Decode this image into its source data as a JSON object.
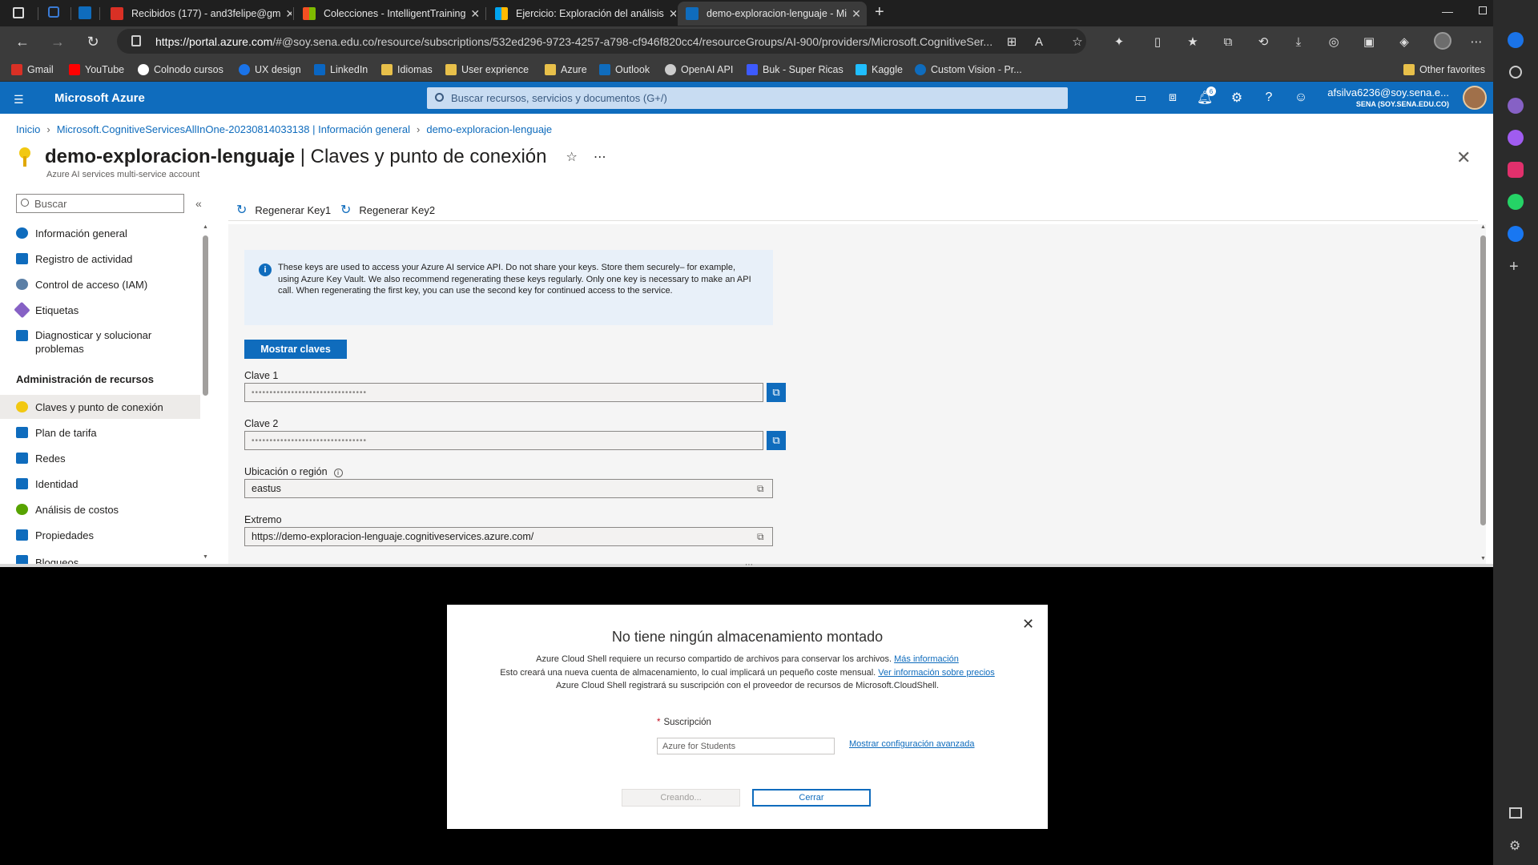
{
  "browser": {
    "tabs": [
      {
        "label": "Recibidos (177) - and3felipe@gm",
        "color": "#d93025"
      },
      {
        "label": "Colecciones - IntelligentTraining",
        "color": "#f2c94c"
      },
      {
        "label": "Ejercicio: Exploración del análisis",
        "color": "#f2c94c"
      },
      {
        "label": "demo-exploracion-lenguaje - Mi",
        "color": "#0f6cbd",
        "active": true
      }
    ],
    "url_host": "https://portal.azure.com",
    "url_path": "/#@soy.sena.edu.co/resource/subscriptions/532ed296-9723-4257-a798-cf946f820cc4/resourceGroups/AI-900/providers/Microsoft.CognitiveSer...",
    "bookmarks": [
      {
        "label": "Gmail",
        "color": "#d93025"
      },
      {
        "label": "YouTube",
        "color": "#ff0000"
      },
      {
        "label": "Colnodo cursos",
        "color": "#ffffff"
      },
      {
        "label": "UX design",
        "color": "#1a73e8"
      },
      {
        "label": "LinkedIn",
        "color": "#0a66c2"
      },
      {
        "label": "Idiomas",
        "color": "#e8c04a"
      },
      {
        "label": "User exprience",
        "color": "#e8c04a"
      },
      {
        "label": "Azure",
        "color": "#e8c04a"
      },
      {
        "label": "Outlook",
        "color": "#0f6cbd"
      },
      {
        "label": "OpenAI API",
        "color": "#cccccc"
      },
      {
        "label": "Buk - Super Ricas",
        "color": "#3d5afe"
      },
      {
        "label": "Kaggle",
        "color": "#20beff"
      },
      {
        "label": "Custom Vision - Pr...",
        "color": "#0f6cbd"
      }
    ],
    "other_favorites": "Other favorites"
  },
  "azure": {
    "brand": "Microsoft Azure",
    "search_placeholder": "Buscar recursos, servicios y documentos (G+/)",
    "notification_count": "6",
    "account_email": "afsilva6236@soy.sena.e...",
    "account_org": "SENA (SOY.SENA.EDU.CO)"
  },
  "breadcrumb": {
    "home": "Inicio",
    "parent": "Microsoft.CognitiveServicesAllInOne-20230814033138 | Información general",
    "current": "demo-exploracion-lenguaje"
  },
  "header": {
    "resource": "demo-exploracion-lenguaje",
    "page": "| Claves y punto de conexión",
    "subtitle": "Azure AI services multi-service account"
  },
  "sidebar": {
    "search_placeholder": "Buscar",
    "items": [
      {
        "label": "Información general",
        "color": "#0f6cbd"
      },
      {
        "label": "Registro de actividad",
        "color": "#0f6cbd"
      },
      {
        "label": "Control de acceso (IAM)",
        "color": "#5b7fa6"
      },
      {
        "label": "Etiquetas",
        "color": "#8661c5"
      },
      {
        "label": "Diagnosticar y solucionar",
        "label2": "problemas",
        "color": "#0f6cbd"
      }
    ],
    "section": "Administración de recursos",
    "items2": [
      {
        "label": "Claves y punto de conexión",
        "color": "#f2c811",
        "selected": true
      },
      {
        "label": "Plan de tarifa",
        "color": "#0f6cbd"
      },
      {
        "label": "Redes",
        "color": "#0f6cbd"
      },
      {
        "label": "Identidad",
        "color": "#0f6cbd"
      },
      {
        "label": "Análisis de costos",
        "color": "#57a300"
      },
      {
        "label": "Propiedades",
        "color": "#0f6cbd"
      },
      {
        "label": "Bloqueos",
        "color": "#0f6cbd"
      }
    ]
  },
  "commands": {
    "regen1": "Regenerar Key1",
    "regen2": "Regenerar Key2"
  },
  "info": "These keys are used to access your Azure AI service API. Do not share your keys. Store them securely– for example, using Azure Key Vault. We also recommend regenerating these keys regularly. Only one key is necessary to make an API call. When regenerating the first key, you can use the second key for continued access to the service.",
  "show_keys": "Mostrar claves",
  "fields": {
    "key1_label": "Clave 1",
    "key1_value": "••••••••••••••••••••••••••••••••",
    "key2_label": "Clave 2",
    "key2_value": "••••••••••••••••••••••••••••••••",
    "region_label": "Ubicación o región",
    "region_value": "eastus",
    "endpoint_label": "Extremo",
    "endpoint_value": "https://demo-exploracion-lenguaje.cognitiveservices.azure.com/"
  },
  "dialog": {
    "title": "No tiene ningún almacenamiento montado",
    "line1": "Azure Cloud Shell requiere un recurso compartido de archivos para conservar los archivos.",
    "line1_link": "Más información",
    "line2": "Esto creará una nueva cuenta de almacenamiento, lo cual implicará un pequeño coste mensual.",
    "line2_link": "Ver información sobre precios",
    "line3": "Azure Cloud Shell registrará su suscripción con el proveedor de recursos de Microsoft.CloudShell.",
    "subscription_label": "Suscripción",
    "subscription_value": "Azure for Students",
    "advanced_link": "Mostrar configuración avanzada",
    "create_button": "Creando...",
    "close_button": "Cerrar"
  }
}
